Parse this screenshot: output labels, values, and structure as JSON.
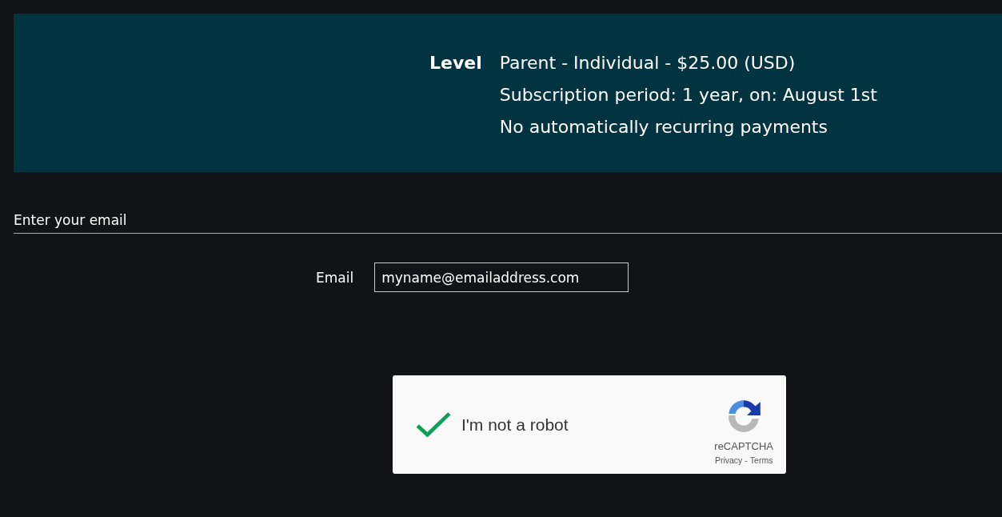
{
  "level": {
    "label": "Level",
    "lines": [
      "Parent - Individual - $25.00 (USD)",
      "Subscription period: 1 year, on: August 1st",
      "No automatically recurring payments"
    ]
  },
  "email_section": {
    "title": "Enter your email",
    "field_label": "Email",
    "value": "myname@emailaddress.com"
  },
  "captcha": {
    "checked": true,
    "label": "I'm not a robot",
    "brand": "reCAPTCHA",
    "privacy": "Privacy",
    "separator": "-",
    "terms": "Terms"
  }
}
